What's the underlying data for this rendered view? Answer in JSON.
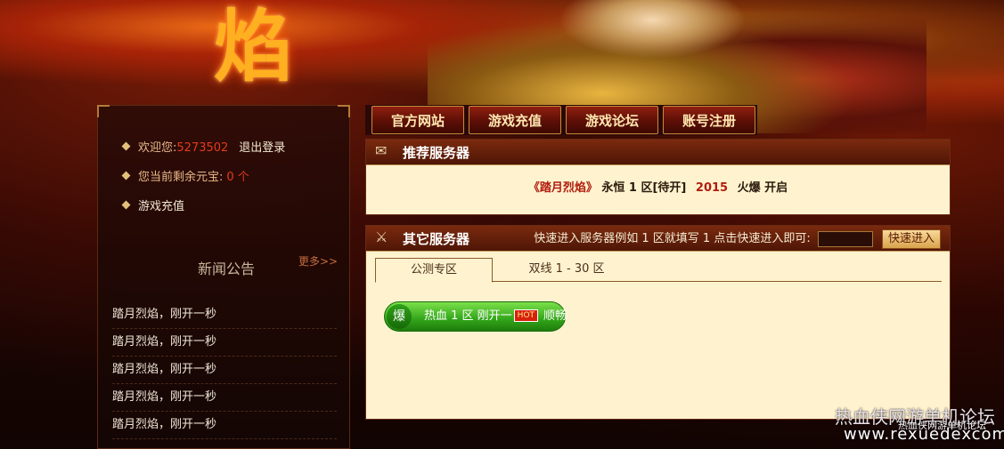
{
  "banner": {
    "logo_glyph": "焰"
  },
  "user": {
    "welcome_prefix": "欢迎您:",
    "user_id": "5273502",
    "logout": "退出登录",
    "balance_prefix": "您当前剩余元宝:",
    "balance_value": "0 个",
    "recharge": "游戏充值"
  },
  "news": {
    "title": "新闻公告",
    "more": "更多>>",
    "items": [
      "踏月烈焰，刚开一秒",
      "踏月烈焰，刚开一秒",
      "踏月烈焰，刚开一秒",
      "踏月烈焰，刚开一秒",
      "踏月烈焰，刚开一秒"
    ]
  },
  "nav": [
    "官方网站",
    "游戏充值",
    "游戏论坛",
    "账号注册"
  ],
  "recommend": {
    "title": "推荐服务器",
    "name": "《踏月烈焰》",
    "zone": "永恒 1 区[待开]",
    "year": "2015",
    "open": "火爆 开启"
  },
  "others": {
    "title": "其它服务器",
    "quick_label": "快速进入服务器例如 1 区就填写 1 点击快速进入即可:",
    "quick_input_value": "",
    "quick_button": "快速进入",
    "tabs": [
      "公测专区",
      "双线 1 - 30 区"
    ],
    "server": {
      "tag": "爆",
      "text": "热血 1 区 刚开一",
      "hot": "HOT",
      "status": "顺畅"
    }
  },
  "watermark": {
    "line1": "热血侠网游单机论坛",
    "line2": "热血侠网游单机论坛",
    "url": "www.rexuedexcom"
  },
  "colors": {
    "accent_red": "#e33b1b",
    "panel_bg": "#fff3cf",
    "server_green": "#32a51a"
  }
}
